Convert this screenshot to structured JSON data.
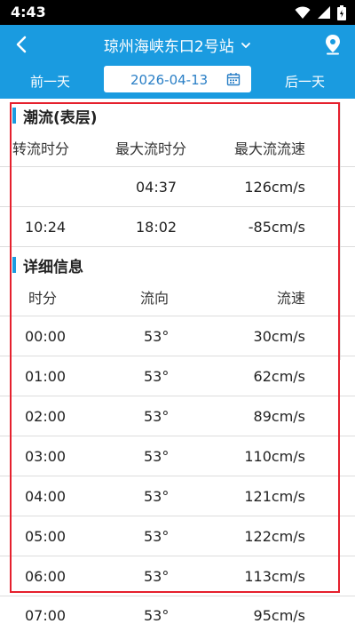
{
  "status_bar": {
    "time": "4:43"
  },
  "header": {
    "title": "琼州海峡东口2号站",
    "prev_day": "前一天",
    "next_day": "后一天",
    "date": "2026-04-13"
  },
  "tide": {
    "section_title": "潮流(表层)",
    "columns": [
      "转流时分",
      "最大流时分",
      "最大流流速"
    ],
    "rows": [
      [
        "",
        "04:37",
        "126cm/s"
      ],
      [
        "10:24",
        "18:02",
        "-85cm/s"
      ]
    ]
  },
  "detail": {
    "section_title": "详细信息",
    "columns": [
      "时分",
      "流向",
      "流速"
    ],
    "rows": [
      [
        "00:00",
        "53°",
        "30cm/s"
      ],
      [
        "01:00",
        "53°",
        "62cm/s"
      ],
      [
        "02:00",
        "53°",
        "89cm/s"
      ],
      [
        "03:00",
        "53°",
        "110cm/s"
      ],
      [
        "04:00",
        "53°",
        "121cm/s"
      ],
      [
        "05:00",
        "53°",
        "122cm/s"
      ],
      [
        "06:00",
        "53°",
        "113cm/s"
      ],
      [
        "07:00",
        "53°",
        "95cm/s"
      ]
    ]
  },
  "colors": {
    "header_bg": "#1a9be0",
    "highlight_border": "#e5202d"
  }
}
